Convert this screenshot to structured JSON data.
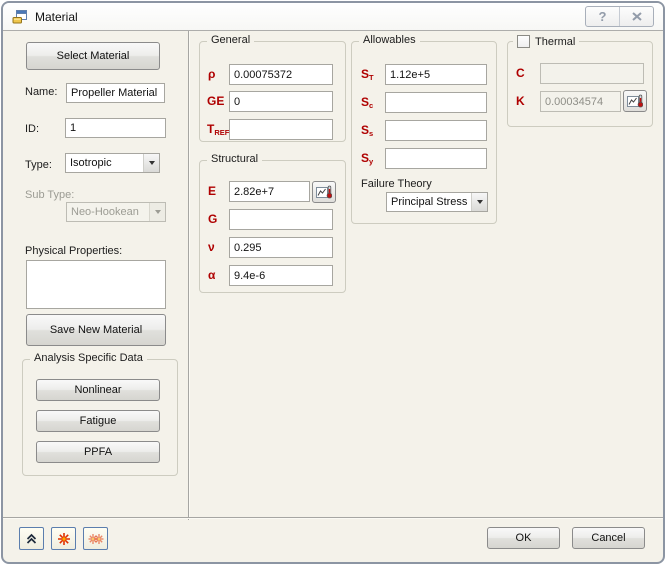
{
  "window": {
    "title": "Material",
    "help_glyph": "?"
  },
  "left": {
    "select_material_button": "Select Material",
    "name_label": "Name:",
    "name_value": "Propeller Material",
    "id_label": "ID:",
    "id_value": "1",
    "type_label": "Type:",
    "type_value": "Isotropic",
    "subtype_label": "Sub Type:",
    "subtype_value": "Neo-Hookean",
    "physical_properties_label": "Physical Properties:",
    "save_new_material_button": "Save New Material",
    "analysis": {
      "title": "Analysis Specific Data",
      "nonlinear_button": "Nonlinear",
      "fatigue_button": "Fatigue",
      "ppfa_button": "PPFA"
    }
  },
  "general": {
    "title": "General",
    "rows": [
      {
        "symbol": "ρ",
        "subscript": "",
        "value": "0.00075372"
      },
      {
        "symbol": "GE",
        "subscript": "",
        "value": "0"
      },
      {
        "symbol": "T",
        "subscript": "REF",
        "value": ""
      }
    ]
  },
  "structural": {
    "title": "Structural",
    "rows": [
      {
        "symbol": "E",
        "subscript": "",
        "value": "2.82e+7"
      },
      {
        "symbol": "G",
        "subscript": "",
        "value": ""
      },
      {
        "symbol": "ν",
        "subscript": "",
        "value": "0.295"
      },
      {
        "symbol": "α",
        "subscript": "",
        "value": "9.4e-6"
      }
    ]
  },
  "allowables": {
    "title": "Allowables",
    "rows": [
      {
        "symbol": "S",
        "subscript": "T",
        "value": "1.12e+5"
      },
      {
        "symbol": "S",
        "subscript": "c",
        "value": ""
      },
      {
        "symbol": "S",
        "subscript": "s",
        "value": ""
      },
      {
        "symbol": "S",
        "subscript": "y",
        "value": ""
      }
    ],
    "failure_theory_label": "Failure Theory",
    "failure_theory_value": "Principal Stress"
  },
  "thermal": {
    "title": "Thermal",
    "c_label": "C",
    "c_value": "",
    "k_label": "K",
    "k_value": "0.00034574"
  },
  "footer": {
    "ok_button": "OK",
    "cancel_button": "Cancel"
  },
  "colors": {
    "dialog_bg": "#F4F2EA",
    "param_label_red": "#AF0000",
    "tool_button_border_blue": "#5B7EAE",
    "starburst_orange": "#E03000"
  }
}
